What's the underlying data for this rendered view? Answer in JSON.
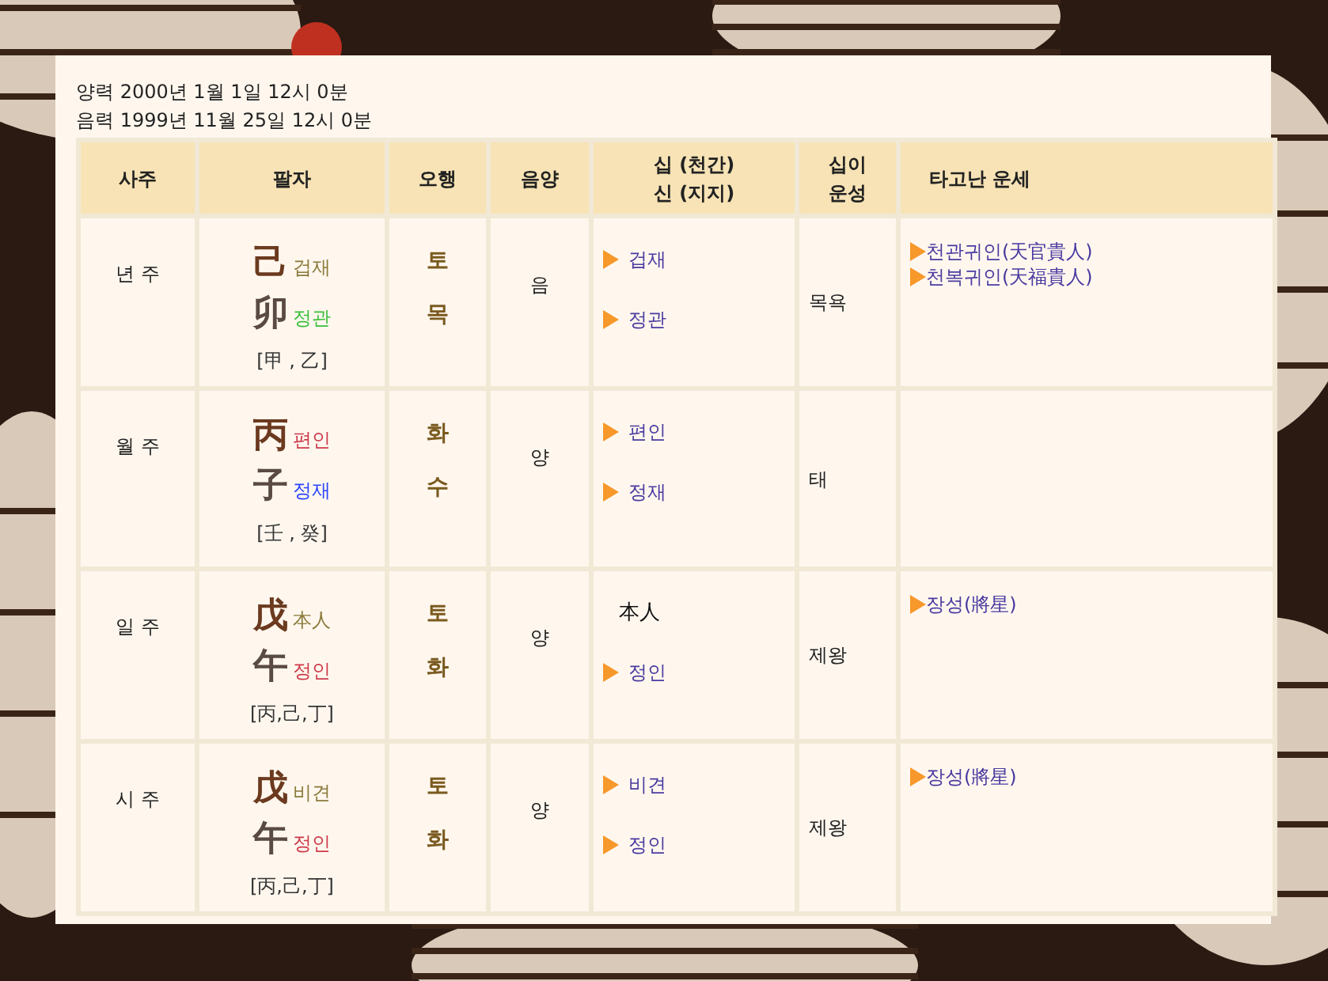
{
  "dates": [
    "양력 2000년 1월 1일 12시 0분",
    "음력 1999년 11월 25일 12시 0분"
  ],
  "table": {
    "columns": [
      {
        "lines": [
          "사주"
        ]
      },
      {
        "lines": [
          "팔자"
        ]
      },
      {
        "lines": [
          "오행"
        ]
      },
      {
        "lines": [
          "음양"
        ]
      },
      {
        "lines": [
          "십 (천간)",
          "신 (지지)"
        ]
      },
      {
        "lines": [
          "십이",
          "운성"
        ]
      },
      {
        "lines": [
          "타고난 운세"
        ]
      }
    ],
    "rows": [
      {
        "pillar": "년 주",
        "stem": {
          "char": "己",
          "god": "겁재",
          "color": "#8a7a3a"
        },
        "branch": {
          "char": "卯",
          "god": "정관",
          "color": "#3cbf3c"
        },
        "hidden": "[甲 , 乙]",
        "elements": [
          "토",
          "목"
        ],
        "yinyang": "음",
        "gods": [
          {
            "kind": "arrow",
            "text": "겁재"
          },
          {
            "kind": "arrow",
            "text": "정관"
          }
        ],
        "stage": "목욕",
        "fortunes": [
          "천관귀인(天官貴人)",
          "천복귀인(天福貴人)"
        ]
      },
      {
        "pillar": "월 주",
        "stem": {
          "char": "丙",
          "god": "편인",
          "color": "#cc3a4a"
        },
        "branch": {
          "char": "子",
          "god": "정재",
          "color": "#2a44ff"
        },
        "hidden": "[壬 , 癸]",
        "elements": [
          "화",
          "수"
        ],
        "yinyang": "양",
        "gods": [
          {
            "kind": "arrow",
            "text": "편인"
          },
          {
            "kind": "arrow",
            "text": "정재"
          }
        ],
        "stage": "태",
        "fortunes": []
      },
      {
        "pillar": "일 주",
        "stem": {
          "char": "戊",
          "god": "本人",
          "color": "#8a7a3a"
        },
        "branch": {
          "char": "午",
          "god": "정인",
          "color": "#cc3a4a"
        },
        "hidden": "[丙,己,丁]",
        "elements": [
          "토",
          "화"
        ],
        "yinyang": "양",
        "gods": [
          {
            "kind": "plain",
            "text": "本人"
          },
          {
            "kind": "arrow",
            "text": "정인"
          }
        ],
        "stage": "제왕",
        "fortunes": [
          "장성(將星)"
        ]
      },
      {
        "pillar": "시 주",
        "stem": {
          "char": "戊",
          "god": "비견",
          "color": "#8a7a3a"
        },
        "branch": {
          "char": "午",
          "god": "정인",
          "color": "#cc3a4a"
        },
        "hidden": "[丙,己,丁]",
        "elements": [
          "토",
          "화"
        ],
        "yinyang": "양",
        "gods": [
          {
            "kind": "arrow",
            "text": "비견"
          },
          {
            "kind": "arrow",
            "text": "정인"
          }
        ],
        "stage": "제왕",
        "fortunes": [
          "장성(將星)"
        ]
      }
    ]
  }
}
